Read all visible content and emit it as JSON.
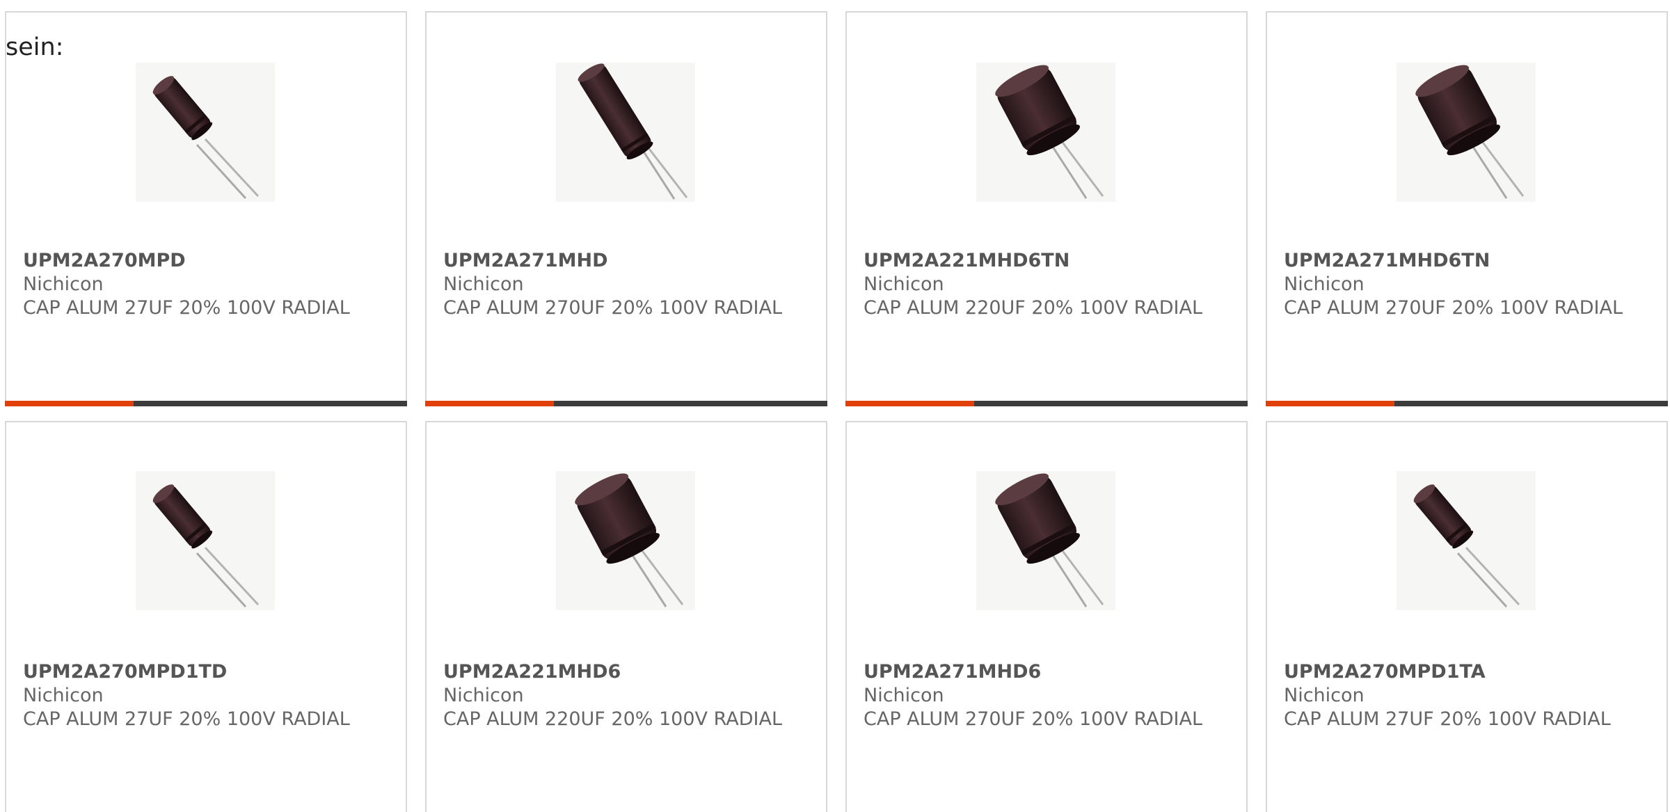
{
  "intro_text": "sein:",
  "colors": {
    "bar_accent": "#e2400b",
    "bar_track": "#3c3c3c",
    "card_border": "#d8d8d8",
    "capacitor_body": "#3a2428"
  },
  "products": [
    {
      "part_number": "UPM2A270MPD",
      "manufacturer": "Nichicon",
      "description": "CAP ALUM 27UF 20% 100V RADIAL",
      "image_icon": "capacitor-image-slim",
      "progress": 0.32
    },
    {
      "part_number": "UPM2A271MHD",
      "manufacturer": "Nichicon",
      "description": "CAP ALUM 270UF 20% 100V RADIAL",
      "image_icon": "capacitor-image-long",
      "progress": 0.32
    },
    {
      "part_number": "UPM2A221MHD6TN",
      "manufacturer": "Nichicon",
      "description": "CAP ALUM 220UF 20% 100V RADIAL",
      "image_icon": "capacitor-image-wide",
      "progress": 0.32
    },
    {
      "part_number": "UPM2A271MHD6TN",
      "manufacturer": "Nichicon",
      "description": "CAP ALUM 270UF 20% 100V RADIAL",
      "image_icon": "capacitor-image-wide",
      "progress": 0.32
    },
    {
      "part_number": "UPM2A270MPD1TD",
      "manufacturer": "Nichicon",
      "description": "CAP ALUM 27UF 20% 100V RADIAL",
      "image_icon": "capacitor-image-slim"
    },
    {
      "part_number": "UPM2A221MHD6",
      "manufacturer": "Nichicon",
      "description": "CAP ALUM 220UF 20% 100V RADIAL",
      "image_icon": "capacitor-image-wide"
    },
    {
      "part_number": "UPM2A271MHD6",
      "manufacturer": "Nichicon",
      "description": "CAP ALUM 270UF 20% 100V RADIAL",
      "image_icon": "capacitor-image-wide"
    },
    {
      "part_number": "UPM2A270MPD1TA",
      "manufacturer": "Nichicon",
      "description": "CAP ALUM 27UF 20% 100V RADIAL",
      "image_icon": "capacitor-image-slim"
    }
  ]
}
